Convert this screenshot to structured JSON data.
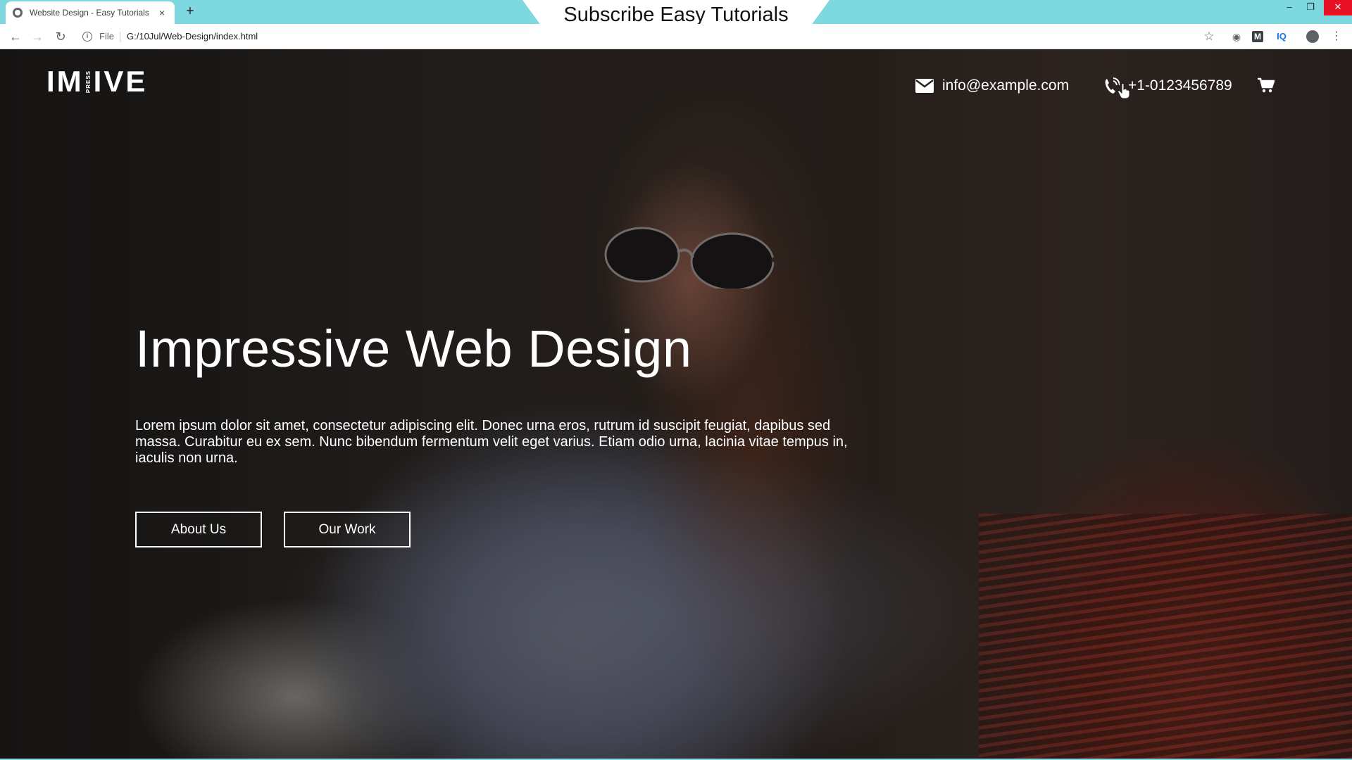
{
  "browser": {
    "tab_title": "Website Design - Easy Tutorials",
    "tab_close": "×",
    "new_tab": "+",
    "address_scheme": "File",
    "url": "G:/10Jul/Web-Design/index.html",
    "accent_color": "#7ed8df"
  },
  "banner": {
    "text": "Subscribe Easy Tutorials"
  },
  "site": {
    "logo_main_left": "IM",
    "logo_vertical": "PRESS",
    "logo_main_right": "IVE",
    "email": "info@example.com",
    "phone": "+1-0123456789",
    "icons": [
      "envelope-icon",
      "phone-icon",
      "cart-icon"
    ]
  },
  "hero": {
    "title": "Impressive Web Design",
    "text": "Lorem ipsum dolor sit amet, consectetur adipiscing elit. Donec urna eros, rutrum id suscipit feugiat, dapibus sed massa. Curabitur eu ex sem. Nunc bibendum fermentum velit eget varius. Etiam odio urna, lacinia vitae tempus in, iaculis non urna.",
    "buttons": [
      {
        "label": "About Us"
      },
      {
        "label": "Our Work"
      }
    ]
  }
}
